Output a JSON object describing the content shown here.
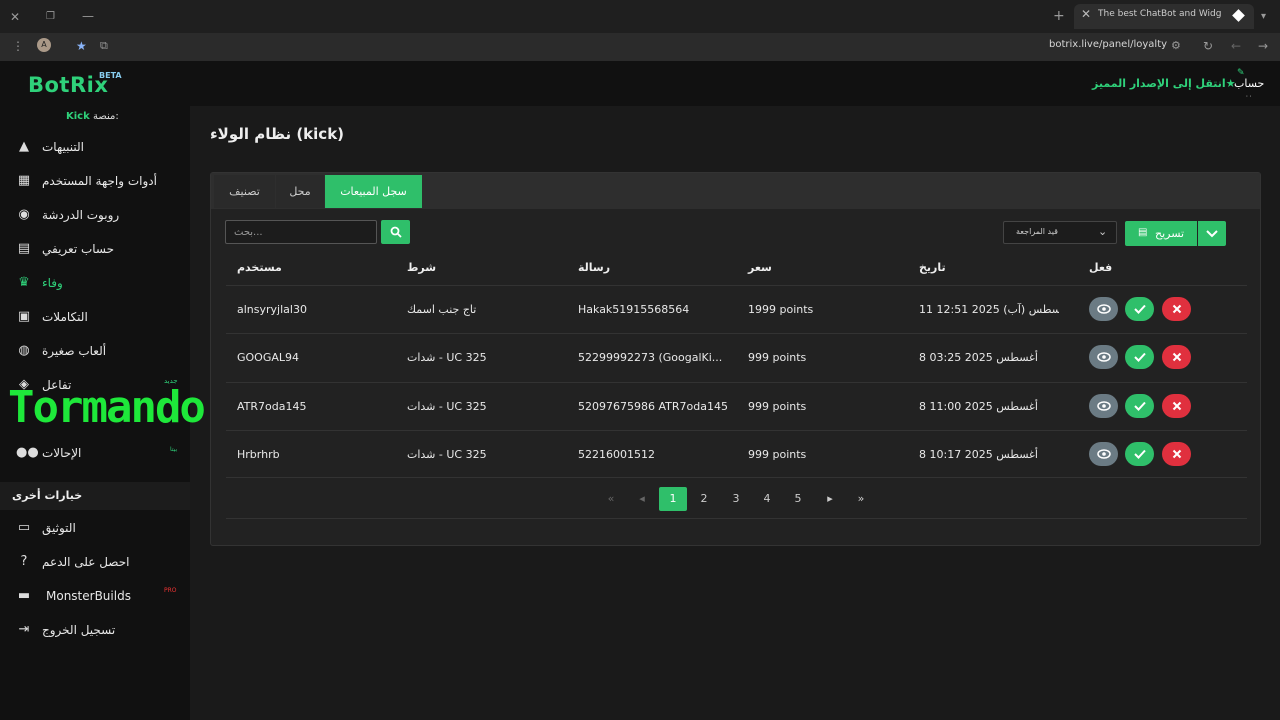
{
  "browser": {
    "tab_title": "The best ChatBot and Widgets",
    "url": "botrix.live/panel/loyalty",
    "profile_initial": "A"
  },
  "header": {
    "logo": "BotRix",
    "beta": "BETA",
    "premium_link": "انتقل إلى الإصدار المميز",
    "account": "حساب",
    "account_sub": "٠٠"
  },
  "sidebar": {
    "platform_label": "منصة:",
    "platform_value": "Kick",
    "items": [
      {
        "label": "التنبيهات",
        "icon": "warning-icon"
      },
      {
        "label": "أدوات واجهة المستخدم",
        "icon": "widgets-icon"
      },
      {
        "label": "روبوت الدردشة",
        "icon": "robot-icon"
      },
      {
        "label": "حساب تعريفي",
        "icon": "id-card-icon"
      },
      {
        "label": "وفاء",
        "icon": "trophy-icon"
      },
      {
        "label": "التكاملات",
        "icon": "integrations-icon"
      },
      {
        "label": "ألعاب صغيرة",
        "icon": "gamepad-icon"
      },
      {
        "label": "تفاعل",
        "icon": "interaction-icon"
      },
      {
        "label": "الإحالات",
        "icon": "users-icon"
      }
    ],
    "badge_new": "جديد",
    "badge_beta": "بيتا",
    "badge_pro": "PRO",
    "other_section": "خيارات أخرى",
    "other_items": [
      {
        "label": "التوثيق",
        "icon": "book-icon"
      },
      {
        "label": "احصل على الدعم",
        "icon": "help-icon"
      },
      {
        "label": "MonsterBuilds",
        "icon": "laptop-icon"
      },
      {
        "label": "تسجيل الخروج",
        "icon": "logout-icon"
      }
    ]
  },
  "watermark": "Tormando (",
  "main": {
    "title": "نظام الولاء (kick)",
    "tabs": [
      "سجل المبيعات",
      "محل",
      "تصنيف"
    ],
    "search_placeholder": "...بحث",
    "filter_value": "قيد المراجعة",
    "export_label": "تسريح",
    "columns": [
      "مستخدم",
      "شرط",
      "رسالة",
      "سعر",
      "تاريخ",
      "فعل"
    ],
    "rows": [
      {
        "user": "alnsyryjlal30",
        "condition": "تاج جنب اسمك",
        "message": "Hakak51915568564",
        "price": "1999 points",
        "date": "11 أغسطس (آب) 2025 12:51"
      },
      {
        "user": "GOOGAL94",
        "condition": "UC 325 - شدات",
        "message": "52299992273 (GoogalKi...",
        "price": "999 points",
        "date": "8 أغسطس 2025 03:25"
      },
      {
        "user": "ATR7oda145",
        "condition": "UC 325 - شدات",
        "message": "52097675986 ATR7oda145",
        "price": "999 points",
        "date": "8 أغسطس 2025 11:00"
      },
      {
        "user": "Hrbrhrb",
        "condition": "UC 325 - شدات",
        "message": "52216001512",
        "price": "999 points",
        "date": "8 أغسطس 2025 10:17"
      }
    ],
    "pages": [
      "1",
      "2",
      "3",
      "4",
      "5"
    ]
  },
  "colors": {
    "accent": "#2fbf6a",
    "danger": "#e0303e",
    "view": "#6b7b84"
  }
}
